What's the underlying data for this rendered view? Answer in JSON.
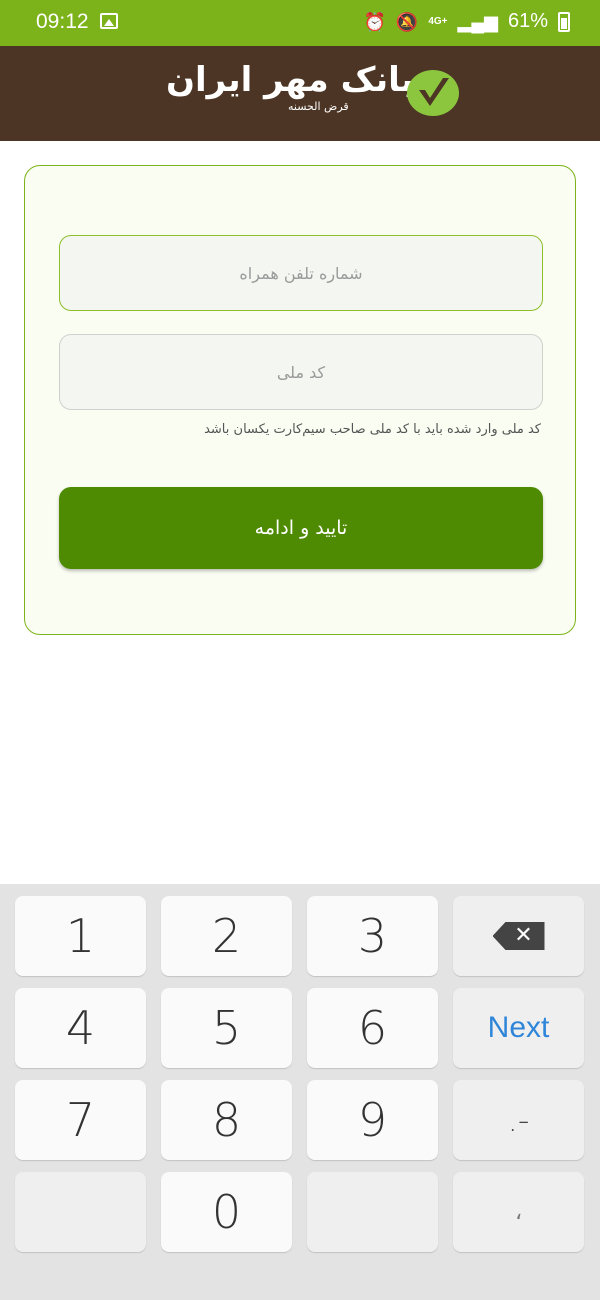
{
  "status_bar": {
    "time": "09:12",
    "network": "4G+",
    "battery": "61%",
    "icons": [
      "gallery-icon",
      "alarm-icon",
      "mute-icon",
      "signal-icon",
      "battery-icon"
    ]
  },
  "header": {
    "logo_text": "بانک مهر ایران",
    "logo_subtitle": "قرض الحسنه"
  },
  "form": {
    "phone_placeholder": "شماره تلفن همراه",
    "national_placeholder": "کد ملی",
    "hint": "کد ملی وارد شده باید با کد ملی صاحب سیم‌کارت یکسان باشد",
    "confirm_label": "تایید و ادامه"
  },
  "keyboard": {
    "keys": [
      "1",
      "2",
      "3",
      "4",
      "5",
      "6",
      "Next",
      "7",
      "8",
      "9",
      ".-",
      "0",
      "،"
    ]
  },
  "colors": {
    "status_bar": "#7db31a",
    "header": "#4c3524",
    "button": "#4e8b03",
    "card_border": "#7db31a",
    "next_key": "#2f86d8"
  }
}
